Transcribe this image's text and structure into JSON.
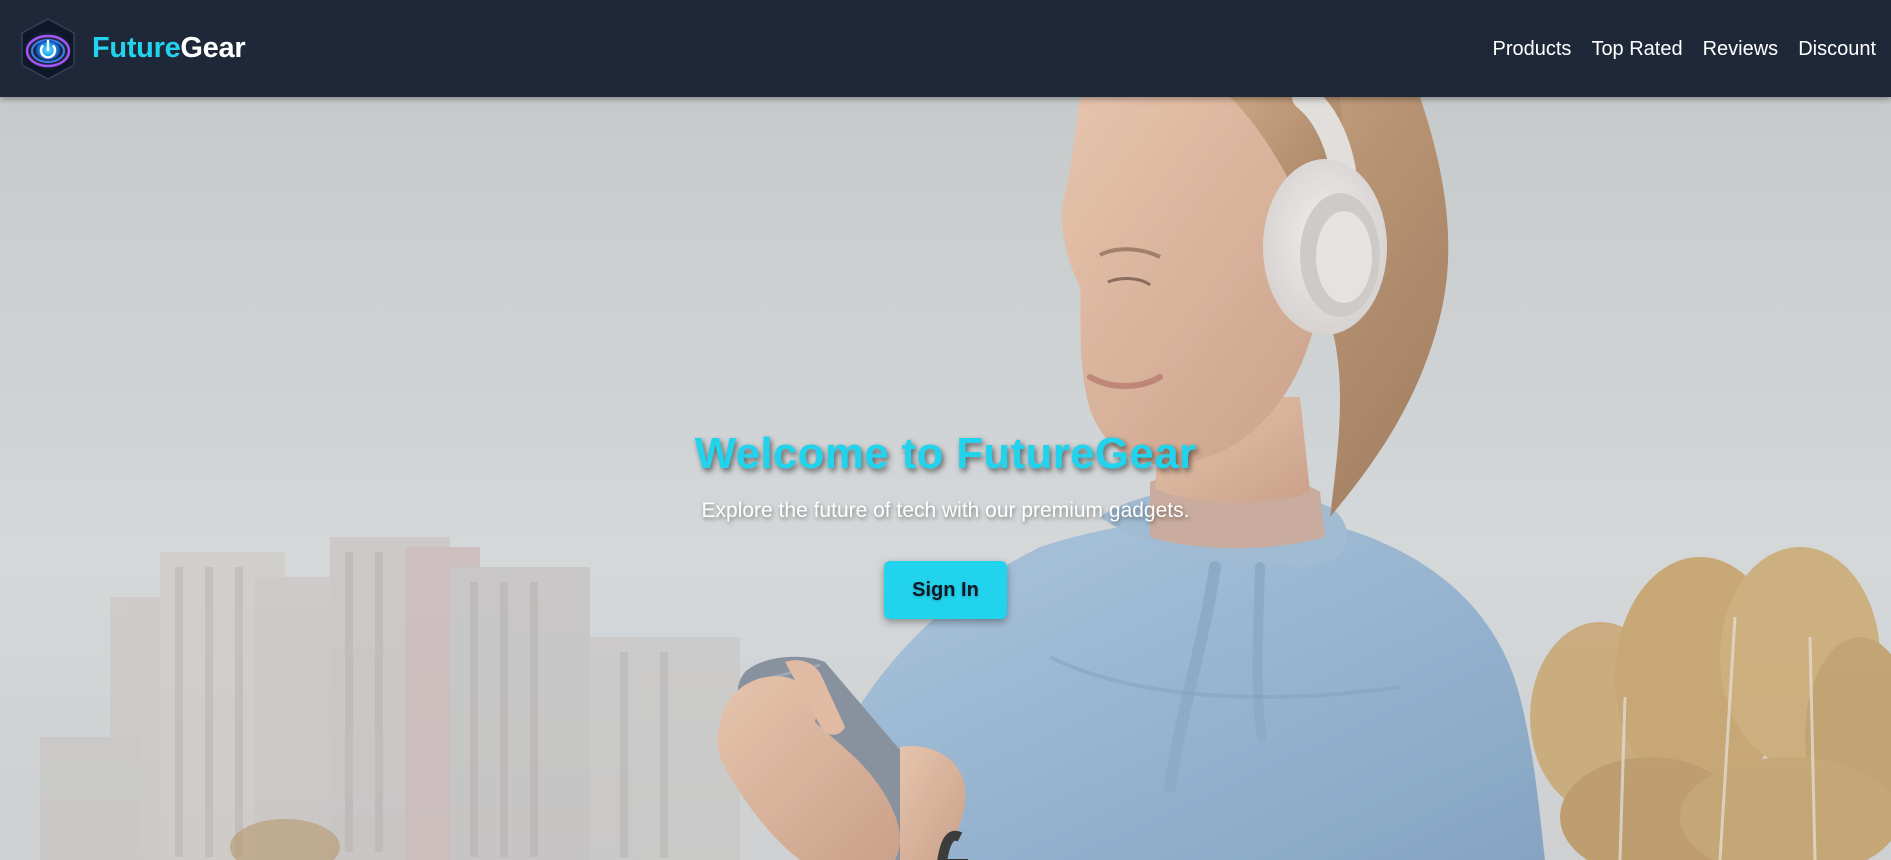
{
  "brand": {
    "name_part1": "Future",
    "name_part2": "Gear",
    "logo_icon": "power-button-logo-icon"
  },
  "nav": {
    "links": [
      {
        "label": "Products"
      },
      {
        "label": "Top Rated"
      },
      {
        "label": "Reviews"
      },
      {
        "label": "Discount"
      }
    ]
  },
  "hero": {
    "title": "Welcome to FutureGear",
    "subtitle": "Explore the future of tech with our premium gadgets.",
    "cta_label": "Sign In",
    "background": "woman-with-headphones-and-phone-photo"
  },
  "colors": {
    "nav_bg": "#1f2838",
    "accent": "#22d3ee",
    "white": "#ffffff",
    "button_text": "#111827"
  }
}
